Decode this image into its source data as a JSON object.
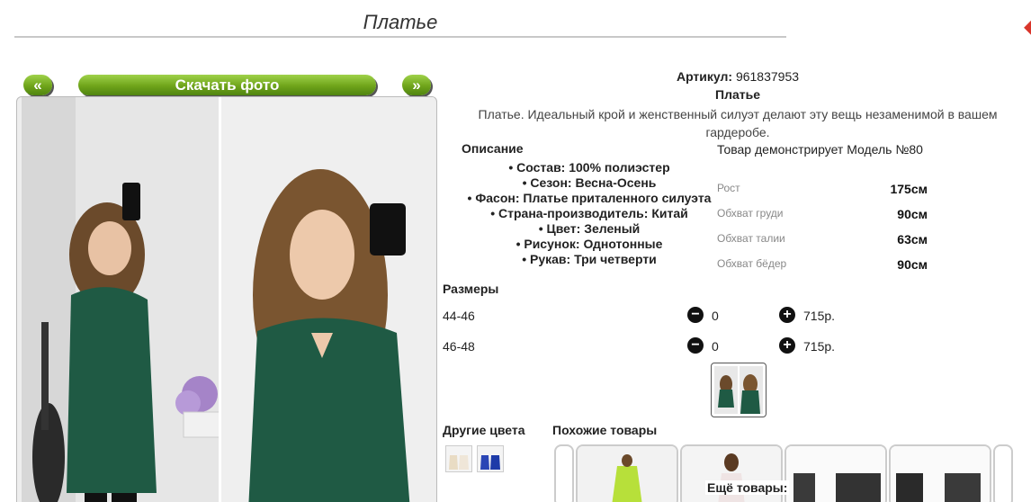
{
  "page": {
    "title": "Платье"
  },
  "gallery": {
    "prev_label": "«",
    "download_label": "Скачать фото",
    "next_label": "»"
  },
  "product": {
    "article_label": "Артикул:",
    "article_value": "961837953",
    "name": "Платье",
    "description": "Платье. Идеальный крой и женственный силуэт делают эту вещь незаменимой в вашем гардеробе."
  },
  "description_section": {
    "label": "Описание",
    "attributes": [
      "Состав: 100% полиэстер",
      "Сезон: Весна-Осень",
      "Фасон: Платье приталенного силуэта",
      "Страна-производитель: Китай",
      "Цвет: Зеленый",
      "Рисунок: Однотонные",
      "Рукав: Три четверти"
    ]
  },
  "model": {
    "note": "Товар демонстрирует Модель №80",
    "measurements": [
      {
        "label": "Рост",
        "value": "175см"
      },
      {
        "label": "Обхват груди",
        "value": "90см"
      },
      {
        "label": "Обхват талии",
        "value": "63см"
      },
      {
        "label": "Обхват бёдер",
        "value": "90см"
      }
    ]
  },
  "sizes": {
    "label": "Размеры",
    "rows": [
      {
        "size": "44-46",
        "minus": "−",
        "qty": "0",
        "plus": "+",
        "price": "715р."
      },
      {
        "size": "46-48",
        "minus": "−",
        "qty": "0",
        "plus": "+",
        "price": "715р."
      }
    ]
  },
  "other_colors": {
    "label": "Другие цвета"
  },
  "similar": {
    "label": "Похожие товары"
  },
  "more": {
    "label": "Ещё товары:"
  },
  "colors": {
    "accent_green": "#6fa41a",
    "dress_green": "#1f5a44"
  }
}
